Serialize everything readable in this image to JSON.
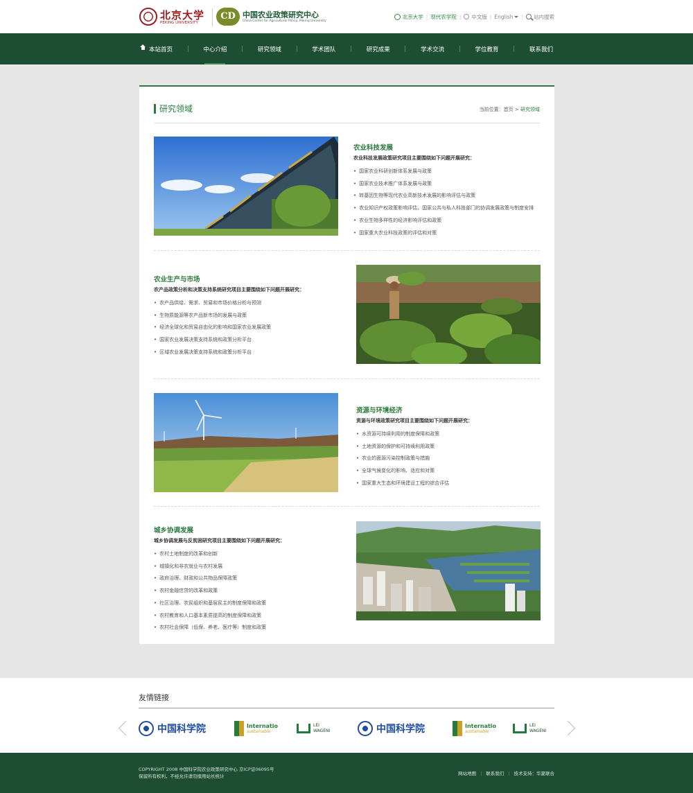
{
  "header": {
    "pku_name": "北京大学",
    "pku_en": "PEKING UNIVERSITY",
    "ccap_name": "中国农业政策研究中心",
    "ccap_en": "China Center for Agricultural Policy, Peking University",
    "ccap_mark": "CD",
    "link_pku": "北京大学",
    "link_sep": "|",
    "link_sam": "现代农学院",
    "lang_cn": "中文版",
    "lang_en": "English",
    "search": "站内搜索"
  },
  "nav": {
    "items": [
      {
        "label": "本站首页"
      },
      {
        "label": "中心介绍"
      },
      {
        "label": "研究领域"
      },
      {
        "label": "学术团队"
      },
      {
        "label": "研究成果"
      },
      {
        "label": "学术交流"
      },
      {
        "label": "学位教育"
      },
      {
        "label": "联系我们"
      }
    ],
    "active_index": 1
  },
  "page": {
    "title": "研究领域",
    "crumb_prefix": "当前位置：首页 > ",
    "crumb_current": "研究领域"
  },
  "sections": [
    {
      "title": "农业科技发展",
      "intro": "农业科技发展政策研究项目主要围绕如下问题开展研究：",
      "items": [
        "国家农业科研创新体系发展与政策",
        "国家农业技术推广体系发展与政策",
        "转基因生物等现代农业高新技术发展的影响评估与政策",
        "农业知识产权政策影响评估，国家公共与私人科技部门的协调发展政策与制度安排",
        "农业生物多样性的经济影响评估和政策",
        "国家重大农业科技政策的评估和对策"
      ],
      "photo": "solar-greenhouse-photo"
    },
    {
      "title": "农业生产与市场",
      "intro": "农产品政策分析和决策支持系统研究项目主要围绕如下问题开展研究：",
      "items": [
        "农产品供给、需求、贸易和市场价格分析与预测",
        "生物质能源等农产品新市场的发展与政策",
        "经济全球化和贸易自由化的影响和国家农业发展政策",
        "国家农业发展决策支持系统和政策分析平台",
        "区域农业发展决策支持系统和政策分析平台"
      ],
      "photo": "farmer-tobacco-field-photo"
    },
    {
      "title": "资源与环境经济",
      "intro": "资源与环境政策研究项目主要围绕如下问题开展研究：",
      "items": [
        "水资源可持续利用的制度保障和政策",
        "土地资源的保护和可持续利用政策",
        "农业的面源污染控制政策与措施",
        "全球气候变化的影响、适应和对策",
        "国家重大生态和环境建设工程的综合评估"
      ],
      "photo": "wind-turbine-fields-photo"
    },
    {
      "title": "城乡协调发展",
      "intro": "城乡协调发展与反贫困研究项目主要围绕如下问题开展研究：",
      "items": [
        "农村土地制度的改革和创新",
        "城镇化和非农就业与农村发展",
        "政府治理、财政和公共物品保障政策",
        "农村金融信贷的改革和政策",
        "社区治理、农民组织和基层民主的制度保障和政策",
        "农村教育和人口基本素质提高的制度保障和政策",
        "农村社会保障（低保、养老、医疗等）制度和政策"
      ],
      "photo": "town-river-aerial-photo"
    }
  ],
  "friends": {
    "title": "友情链接",
    "partners": [
      {
        "name": "中国科学院",
        "kind": "cas"
      },
      {
        "name": "Internatio",
        "sub": "sustainable",
        "kind": "ifpri"
      },
      {
        "name": "LEI",
        "sub": "WAGENI",
        "kind": "lei"
      },
      {
        "name": "中国科学院",
        "kind": "cas"
      },
      {
        "name": "Internatio",
        "sub": "sustainable",
        "kind": "ifpri"
      },
      {
        "name": "LEI",
        "sub": "WAGENI",
        "kind": "lei"
      }
    ]
  },
  "footer": {
    "line1": "COPYRIGHT 2008    中国科学院农业政策研究中心    京ICP证06095号",
    "line2": "保留所有权利，不经允许请勿擅用站长统计",
    "link_map": "网站地图",
    "link_contact": "联系我们",
    "tech": "技术支持：华夏联合"
  },
  "colors": {
    "brand_green": "#1d4d33",
    "accent_green": "#2a7a3c",
    "pku_red": "#9b1b1e",
    "cas_blue": "#1f4ca0"
  }
}
